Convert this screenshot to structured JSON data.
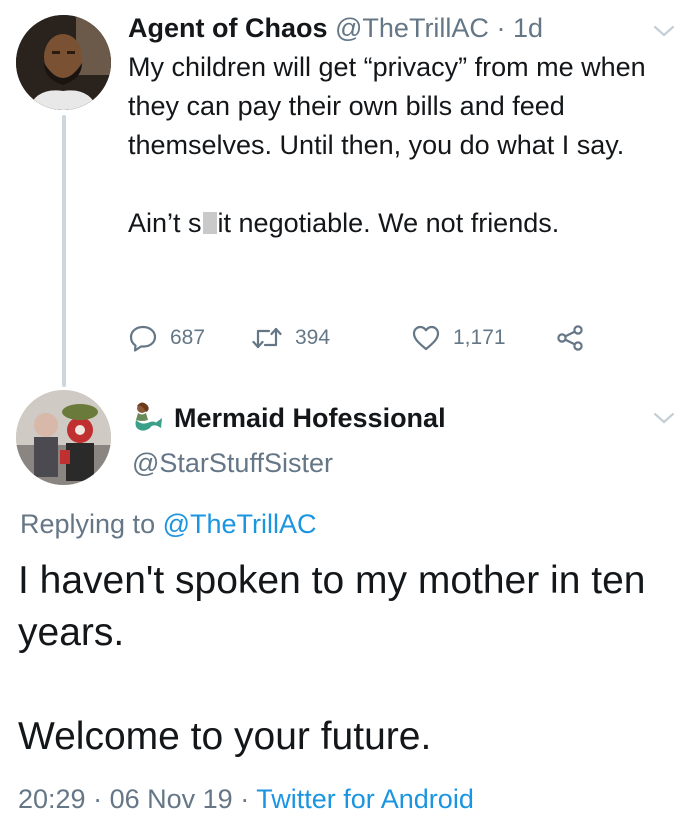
{
  "thread_line_color": "#ccd6dd",
  "link_color": "#1b95e0",
  "tweet1": {
    "name": "Agent of Chaos",
    "handle": "@TheTrillAC",
    "separator": "·",
    "time": "1d",
    "text_line1": "My children will get “privacy” from me when they can pay their own bills and feed themselves. Until then, you do what I say.",
    "text_line2_before": "Ain’t s",
    "text_line2_after": "it negotiable. We not friends.",
    "reply_count": "687",
    "retweet_count": "394",
    "like_count": "1,171",
    "icons": [
      "reply-icon",
      "retweet-icon",
      "heart-icon",
      "share-icon",
      "chevron-down-icon"
    ]
  },
  "tweet2": {
    "name": "Mermaid Hofessional",
    "handle": "@StarStuffSister",
    "name_emoji": "🧜‍♀️",
    "replying_prefix": "Replying to",
    "replying_handle": "@TheTrillAC",
    "text_para1": "I haven't spoken to my mother in ten years.",
    "text_para2": "Welcome to your future.",
    "time": "20:29",
    "separator1": "·",
    "date": "06 Nov 19",
    "separator2": "·",
    "source": "Twitter for Android"
  }
}
